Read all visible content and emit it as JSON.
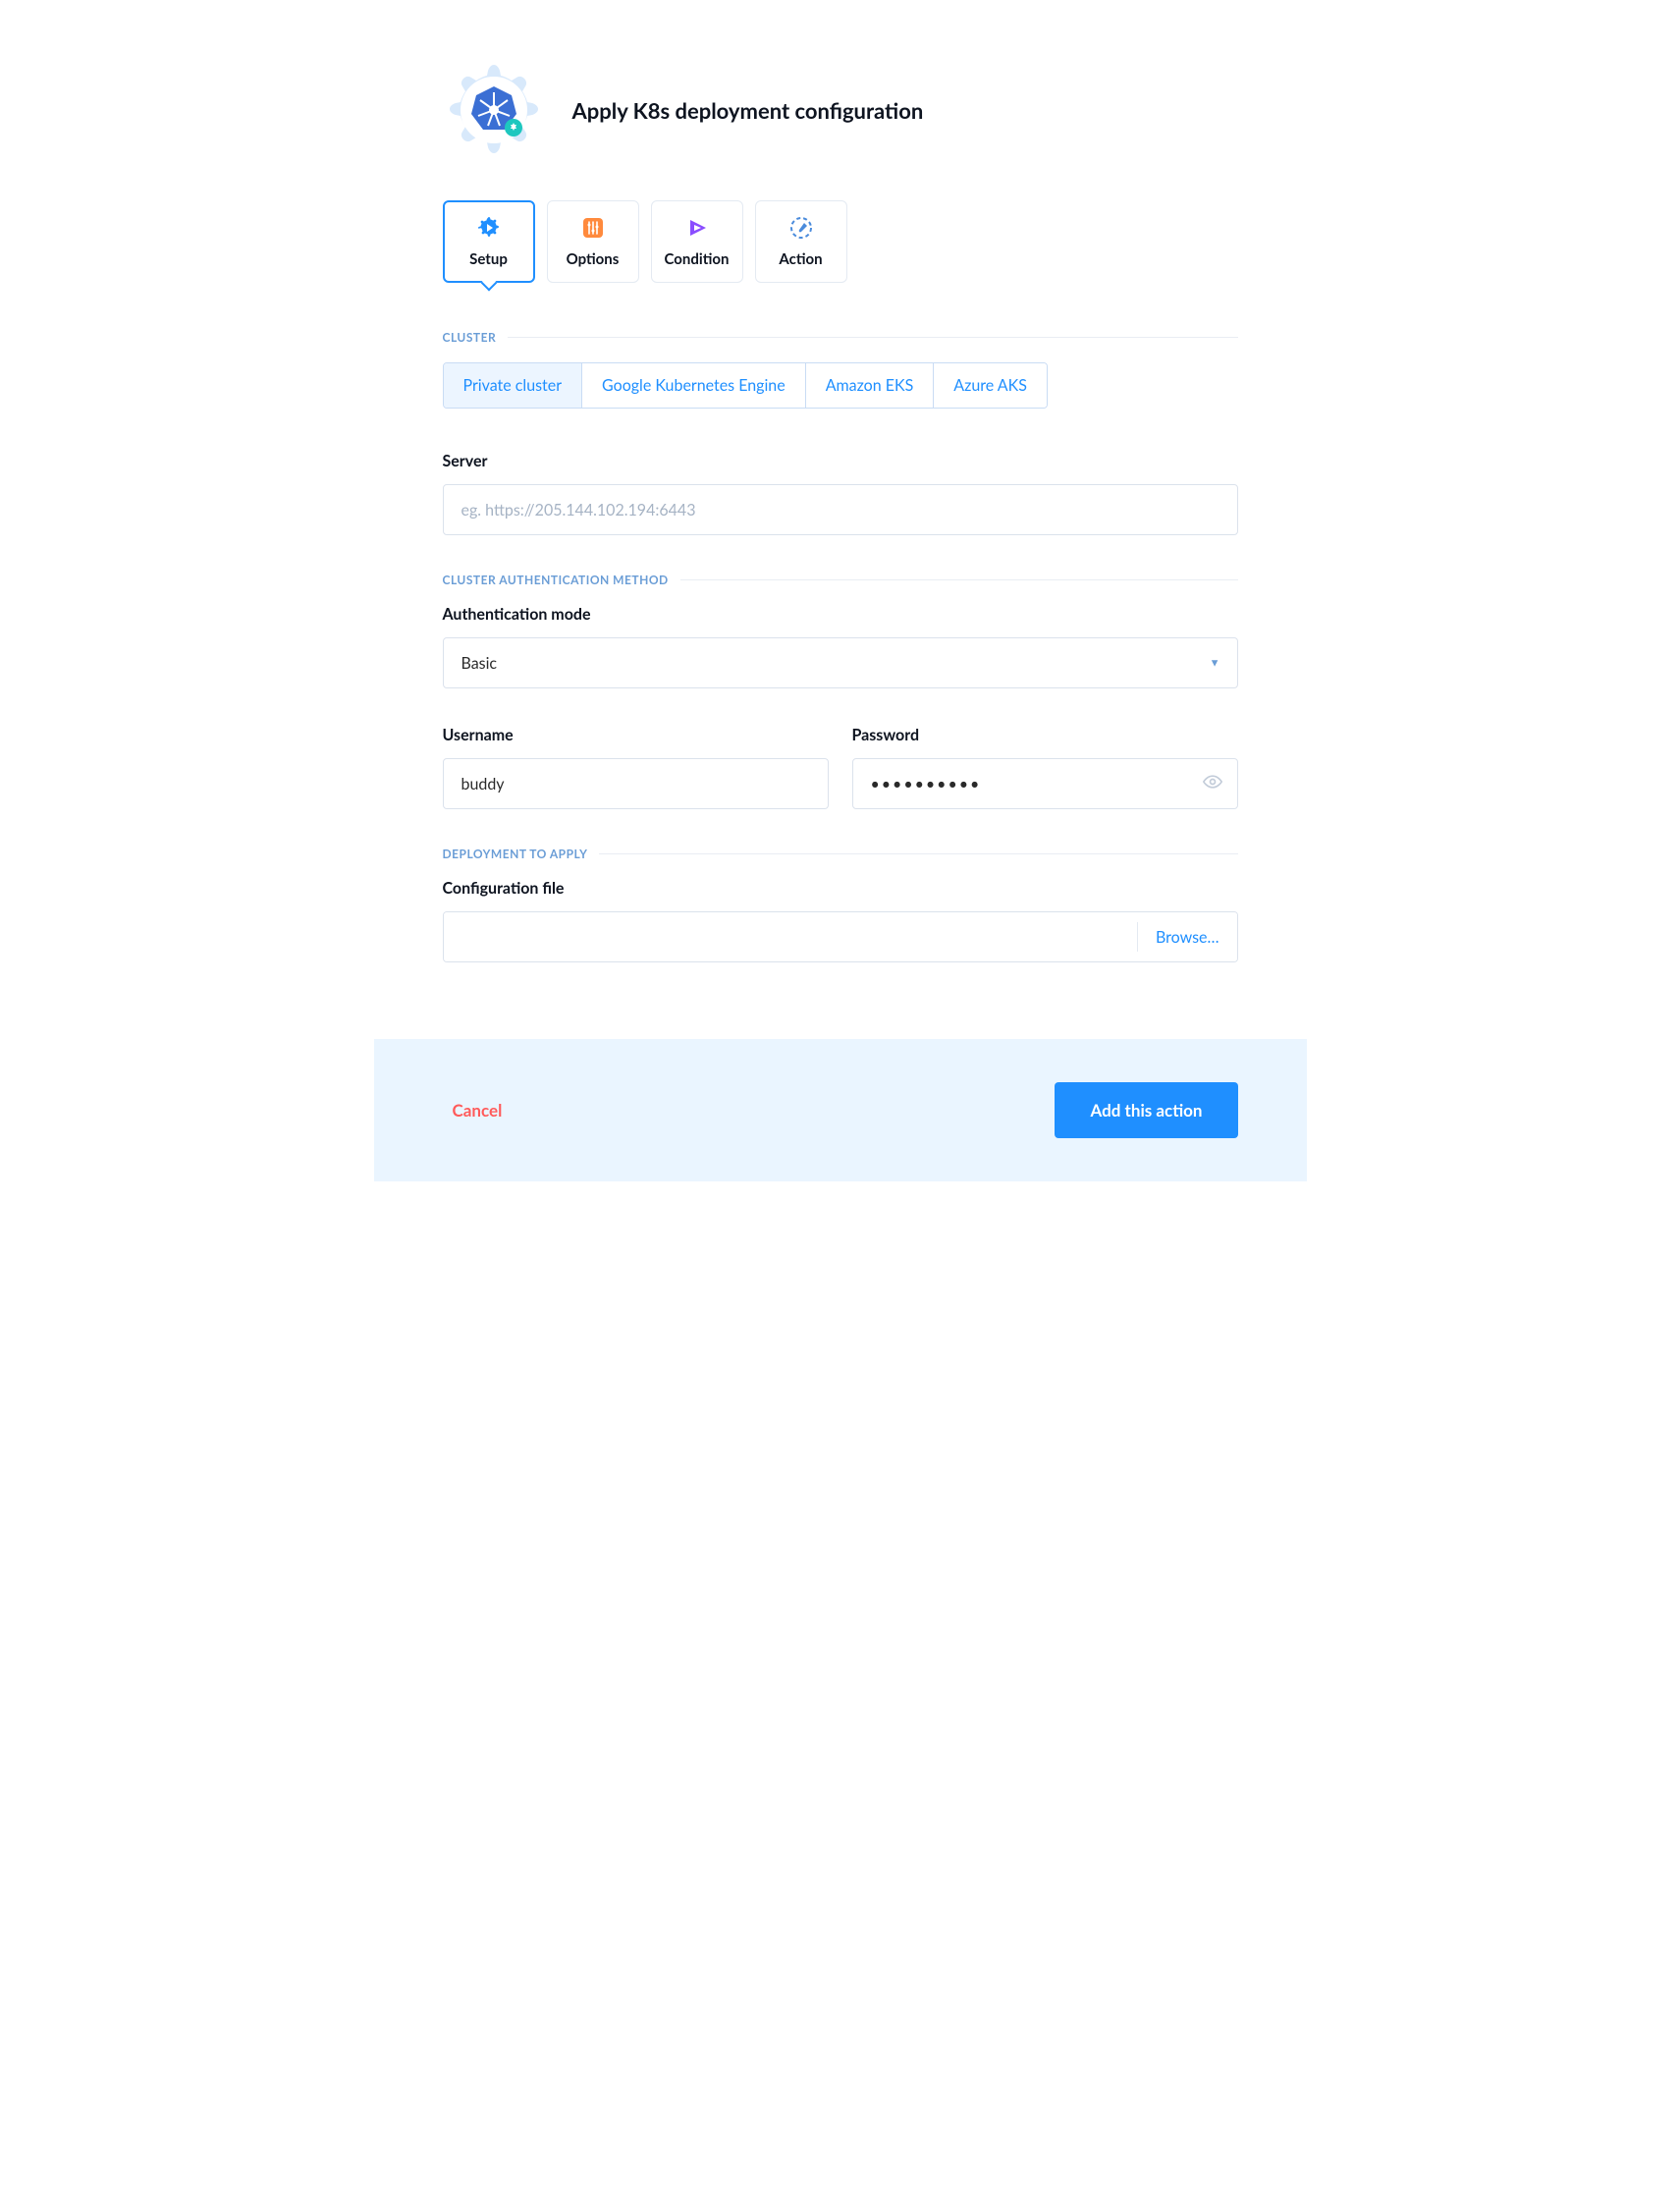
{
  "header": {
    "title": "Apply K8s deployment configuration"
  },
  "tabs": [
    {
      "label": "Setup",
      "active": true
    },
    {
      "label": "Options",
      "active": false
    },
    {
      "label": "Condition",
      "active": false
    },
    {
      "label": "Action",
      "active": false
    }
  ],
  "sections": {
    "cluster_label": "CLUSTER",
    "auth_label": "CLUSTER AUTHENTICATION METHOD",
    "deploy_label": "DEPLOYMENT TO APPLY"
  },
  "cluster_options": [
    {
      "label": "Private cluster",
      "active": true
    },
    {
      "label": "Google Kubernetes Engine",
      "active": false
    },
    {
      "label": "Amazon EKS",
      "active": false
    },
    {
      "label": "Azure AKS",
      "active": false
    }
  ],
  "fields": {
    "server_label": "Server",
    "server_placeholder": "eg. https://205.144.102.194:6443",
    "server_value": "",
    "auth_mode_label": "Authentication mode",
    "auth_mode_value": "Basic",
    "username_label": "Username",
    "username_value": "buddy",
    "password_label": "Password",
    "password_value": "••••••••••",
    "config_label": "Configuration file",
    "config_value": "",
    "browse_label": "Browse…"
  },
  "footer": {
    "cancel_label": "Cancel",
    "primary_label": "Add this action"
  }
}
